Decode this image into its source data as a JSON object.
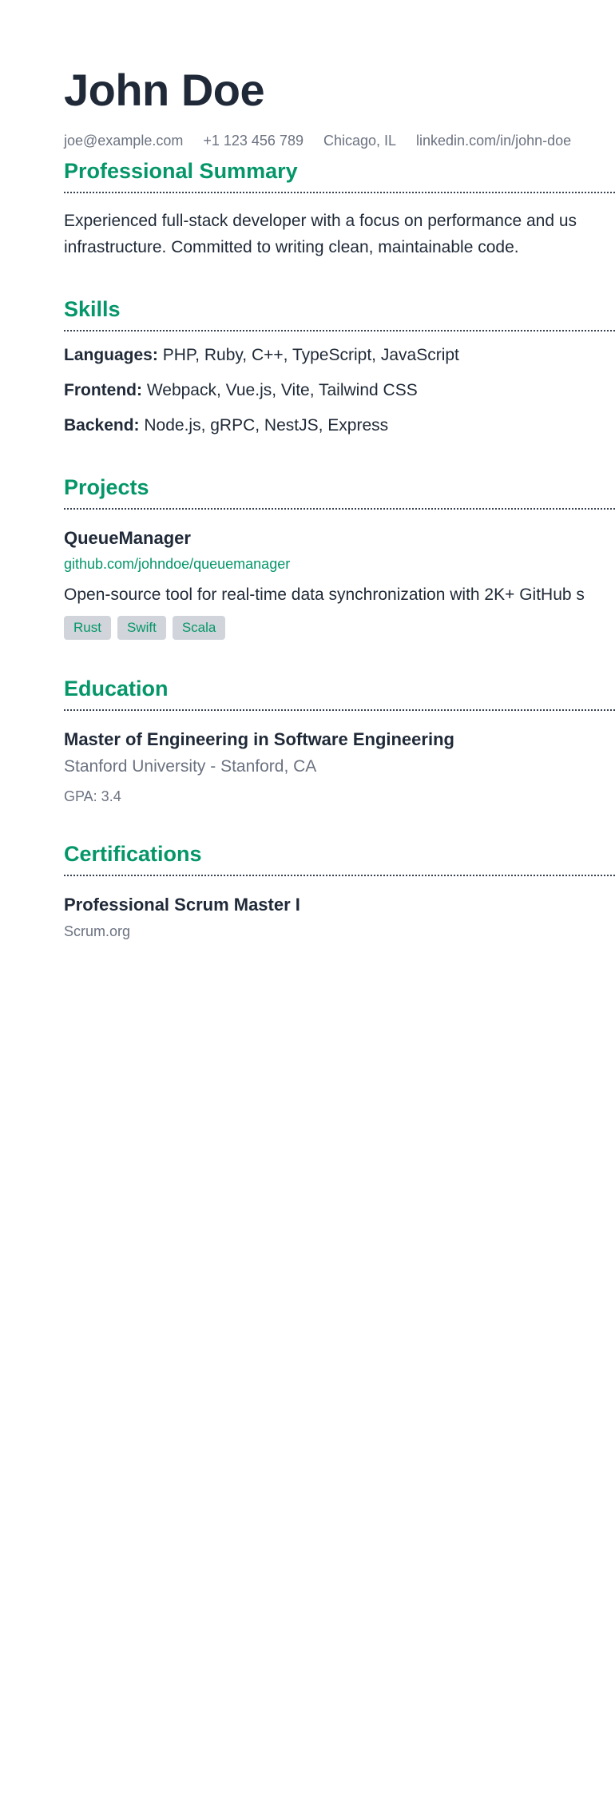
{
  "header": {
    "name": "John Doe",
    "contact": {
      "email": "joe@example.com",
      "phone": "+1 123 456 789",
      "location": "Chicago, IL",
      "linkedin": "linkedin.com/in/john-doe"
    }
  },
  "summary": {
    "title": "Professional Summary",
    "line1": "Experienced full-stack developer with a focus on performance and us",
    "line2": "infrastructure. Committed to writing clean, maintainable code."
  },
  "skills": {
    "title": "Skills",
    "items": [
      {
        "label": "Languages:",
        "value": "PHP, Ruby, C++, TypeScript, JavaScript"
      },
      {
        "label": "Frontend:",
        "value": "Webpack, Vue.js, Vite, Tailwind CSS"
      },
      {
        "label": "Backend:",
        "value": "Node.js, gRPC, NestJS, Express"
      }
    ]
  },
  "projects": {
    "title": "Projects",
    "items": [
      {
        "name": "QueueManager",
        "link": "github.com/johndoe/queuemanager",
        "description": "Open-source tool for real-time data synchronization with 2K+ GitHub s",
        "tags": [
          "Rust",
          "Swift",
          "Scala"
        ]
      }
    ]
  },
  "education": {
    "title": "Education",
    "degree": "Master of Engineering in Software Engineering",
    "school": "Stanford University - Stanford, CA",
    "gpa": "GPA: 3.4"
  },
  "certifications": {
    "title": "Certifications",
    "name": "Professional Scrum Master I",
    "issuer": "Scrum.org"
  },
  "colors": {
    "accent": "#059669",
    "text": "#1f2937",
    "muted": "#6b7280",
    "tag_bg": "#d1d5db"
  }
}
